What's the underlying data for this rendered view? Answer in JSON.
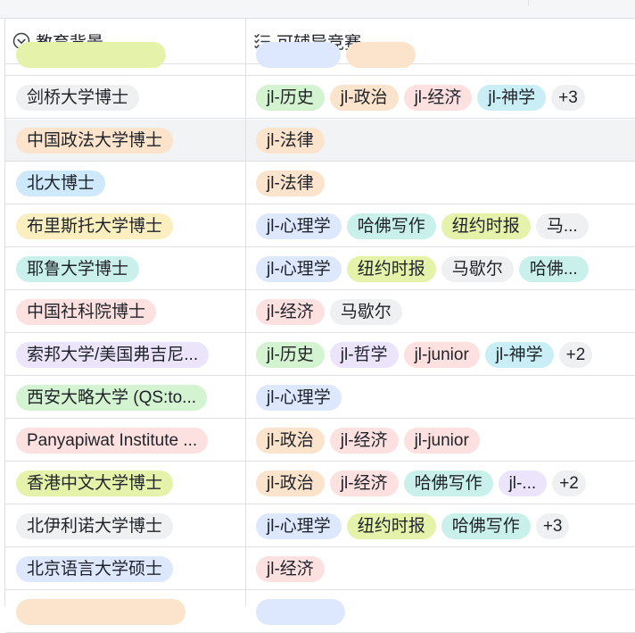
{
  "columns": [
    {
      "label": "教育背景",
      "icon": "chevron-down-circle-icon"
    },
    {
      "label": "可辅导竞赛",
      "icon": "checklist-icon"
    }
  ],
  "colors": {
    "gray": "#eff0f1",
    "orange": "#fbe3cc",
    "blue": "#cde9fb",
    "yellow": "#fbefc0",
    "teal": "#c9f0eb",
    "pink": "#fde0e0",
    "purple": "#ebe4fb",
    "green": "#d4f3d0",
    "lime": "#e4f3a9",
    "periwinkle": "#dde7fd",
    "cyan": "#c9eef5"
  },
  "rows": [
    {
      "edu": {
        "text": "",
        "color": "lime"
      },
      "tags": [
        {
          "text": "",
          "color": "periwinkle",
          "w": 95
        },
        {
          "text": "",
          "color": "orange",
          "w": 78
        }
      ],
      "partial": true
    },
    {
      "edu": {
        "text": "剑桥大学博士",
        "color": "gray"
      },
      "tags": [
        {
          "text": "jl-历史",
          "color": "green"
        },
        {
          "text": "jl-政治",
          "color": "orange"
        },
        {
          "text": "jl-经济",
          "color": "pink"
        },
        {
          "text": "jl-神学",
          "color": "cyan"
        },
        {
          "text": "+3",
          "color": "gray",
          "more": true
        }
      ]
    },
    {
      "edu": {
        "text": "中国政法大学博士",
        "color": "orange"
      },
      "tags": [
        {
          "text": "jl-法律",
          "color": "orange"
        }
      ],
      "highlight": true
    },
    {
      "edu": {
        "text": "北大博士",
        "color": "blue"
      },
      "tags": [
        {
          "text": "jl-法律",
          "color": "orange"
        }
      ]
    },
    {
      "edu": {
        "text": "布里斯托大学博士",
        "color": "yellow"
      },
      "tags": [
        {
          "text": "jl-心理学",
          "color": "periwinkle"
        },
        {
          "text": "哈佛写作",
          "color": "teal"
        },
        {
          "text": "纽约时报",
          "color": "lime"
        },
        {
          "text": "马...",
          "color": "gray"
        }
      ]
    },
    {
      "edu": {
        "text": "耶鲁大学博士",
        "color": "teal"
      },
      "tags": [
        {
          "text": "jl-心理学",
          "color": "periwinkle"
        },
        {
          "text": "纽约时报",
          "color": "lime"
        },
        {
          "text": "马歇尔",
          "color": "gray"
        },
        {
          "text": "哈佛...",
          "color": "teal"
        }
      ]
    },
    {
      "edu": {
        "text": "中国社科院博士",
        "color": "pink"
      },
      "tags": [
        {
          "text": "jl-经济",
          "color": "pink"
        },
        {
          "text": "马歇尔",
          "color": "gray"
        }
      ]
    },
    {
      "edu": {
        "text": "索邦大学/美国弗吉尼...",
        "color": "purple"
      },
      "tags": [
        {
          "text": "jl-历史",
          "color": "green"
        },
        {
          "text": "jl-哲学",
          "color": "purple"
        },
        {
          "text": "jl-junior",
          "color": "pink"
        },
        {
          "text": "jl-神学",
          "color": "cyan"
        },
        {
          "text": "+2",
          "color": "gray",
          "more": true
        }
      ]
    },
    {
      "edu": {
        "text": "西安大略大学 (QS:to...",
        "color": "green"
      },
      "tags": [
        {
          "text": "jl-心理学",
          "color": "periwinkle"
        }
      ]
    },
    {
      "edu": {
        "text": "Panyapiwat Institute ...",
        "color": "pink"
      },
      "tags": [
        {
          "text": "jl-政治",
          "color": "orange"
        },
        {
          "text": "jl-经济",
          "color": "pink"
        },
        {
          "text": "jl-junior",
          "color": "pink"
        }
      ]
    },
    {
      "edu": {
        "text": "香港中文大学博士",
        "color": "lime"
      },
      "tags": [
        {
          "text": "jl-政治",
          "color": "orange"
        },
        {
          "text": "jl-经济",
          "color": "pink"
        },
        {
          "text": "哈佛写作",
          "color": "teal"
        },
        {
          "text": "jl-...",
          "color": "purple"
        },
        {
          "text": "+2",
          "color": "gray",
          "more": true
        }
      ]
    },
    {
      "edu": {
        "text": "北伊利诺大学博士",
        "color": "gray"
      },
      "tags": [
        {
          "text": "jl-心理学",
          "color": "periwinkle"
        },
        {
          "text": "纽约时报",
          "color": "lime"
        },
        {
          "text": "哈佛写作",
          "color": "teal"
        },
        {
          "text": "+3",
          "color": "gray",
          "more": true
        }
      ]
    },
    {
      "edu": {
        "text": "北京语言大学硕士",
        "color": "periwinkle"
      },
      "tags": [
        {
          "text": "jl-经济",
          "color": "pink"
        }
      ]
    },
    {
      "edu": {
        "text": "",
        "color": "orange"
      },
      "tags": [
        {
          "text": "",
          "color": "periwinkle",
          "w": 100
        }
      ],
      "partial": true
    }
  ]
}
